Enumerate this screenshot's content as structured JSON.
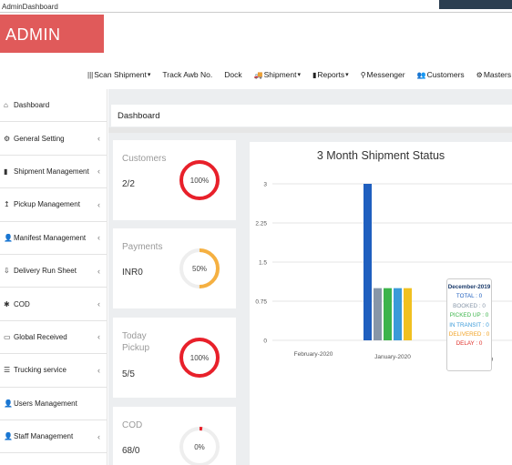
{
  "window": {
    "title": "AdminDashboard"
  },
  "brand": {
    "title": "ADMIN"
  },
  "topnav": {
    "items": [
      {
        "label": "Scan Shipment",
        "icon": "barcode-icon",
        "glyph": "|||",
        "caret": "▾"
      },
      {
        "label": "Track Awb No.",
        "icon": "",
        "glyph": "",
        "caret": ""
      },
      {
        "label": "Dock",
        "icon": "",
        "glyph": "",
        "caret": ""
      },
      {
        "label": "Shipment",
        "icon": "truck-icon",
        "glyph": "🚚",
        "caret": "▾"
      },
      {
        "label": "Reports",
        "icon": "chart-icon",
        "glyph": "▮",
        "caret": "▾"
      },
      {
        "label": "Messenger",
        "icon": "location-icon",
        "glyph": "⚲",
        "caret": ""
      },
      {
        "label": "Customers",
        "icon": "users-icon",
        "glyph": "👥",
        "caret": ""
      },
      {
        "label": "Masters",
        "icon": "cogs-icon",
        "glyph": "⚙",
        "caret": ""
      },
      {
        "label": "",
        "icon": "user-icon",
        "glyph": "👤",
        "caret": "▾"
      }
    ]
  },
  "sidebar": {
    "items": [
      {
        "label": "Dashboard",
        "glyph": "⌂",
        "chevron": ""
      },
      {
        "label": "General Setting",
        "glyph": "⚙",
        "chevron": "‹"
      },
      {
        "label": "Shipment Management",
        "glyph": "▮",
        "chevron": "‹"
      },
      {
        "label": "Pickup Management",
        "glyph": "↥",
        "chevron": "‹"
      },
      {
        "label": "Manifest Management",
        "glyph": "👤",
        "chevron": "‹"
      },
      {
        "label": "Delivery Run Sheet",
        "glyph": "⇩",
        "chevron": "‹"
      },
      {
        "label": "COD",
        "glyph": "✱",
        "chevron": "‹"
      },
      {
        "label": "Global Received",
        "glyph": "▭",
        "chevron": "‹"
      },
      {
        "label": "Trucking service",
        "glyph": "☰",
        "chevron": "‹"
      },
      {
        "label": "Users Management",
        "glyph": "👤",
        "chevron": ""
      },
      {
        "label": "Staff Management",
        "glyph": "👤",
        "chevron": "‹"
      }
    ]
  },
  "main": {
    "heading": "Dashboard"
  },
  "cards": [
    {
      "title": "Customers",
      "value": "2/2",
      "percent_label": "100%",
      "percent": 100,
      "color": "#e8202a"
    },
    {
      "title": "Payments",
      "value": "INR0",
      "percent_label": "50%",
      "percent": 50,
      "color": "#f5b041"
    },
    {
      "title": "Today\nPickup",
      "value": "5/5",
      "percent_label": "100%",
      "percent": 100,
      "color": "#e8202a"
    },
    {
      "title": "COD",
      "value": "68/0",
      "percent_label": "0%",
      "percent": 0,
      "color": "#e8202a"
    }
  ],
  "chart_data": {
    "type": "bar",
    "title": "3 Month Shipment Status",
    "categories": [
      "February-2020",
      "January-2020",
      "December-2019"
    ],
    "yticks": [
      "3",
      "2.25",
      "1.5",
      "0.75",
      "0"
    ],
    "ylim": [
      0,
      3
    ],
    "grid": true,
    "series": [
      {
        "name": "TOTAL",
        "color": "#1f5fbf",
        "values": [
          0,
          3,
          0
        ]
      },
      {
        "name": "BOOKED",
        "color": "#8796a8",
        "values": [
          0,
          1,
          0
        ]
      },
      {
        "name": "PICKED UP",
        "color": "#3cb44b",
        "values": [
          0,
          1,
          0
        ]
      },
      {
        "name": "IN TRANSIT",
        "color": "#3a9ad9",
        "values": [
          0,
          1,
          0
        ]
      },
      {
        "name": "DELIVERED",
        "color": "#f0c020",
        "values": [
          0,
          1,
          0
        ]
      },
      {
        "name": "DELAY",
        "color": "#e0312b",
        "values": [
          0,
          0,
          0
        ]
      }
    ],
    "tooltip": {
      "title": "December-2019",
      "rows": [
        {
          "label": "TOTAL : 0",
          "color": "#1f5fbf"
        },
        {
          "label": "BOOKED : 0",
          "color": "#8796a8"
        },
        {
          "label": "PICKED UP : 0",
          "color": "#3cb44b"
        },
        {
          "label": "IN TRANSIT : 0",
          "color": "#3a9ad9"
        },
        {
          "label": "DELIVERED : 0",
          "color": "#f0a020"
        },
        {
          "label": "DELAY : 0",
          "color": "#e0312b"
        }
      ]
    }
  }
}
